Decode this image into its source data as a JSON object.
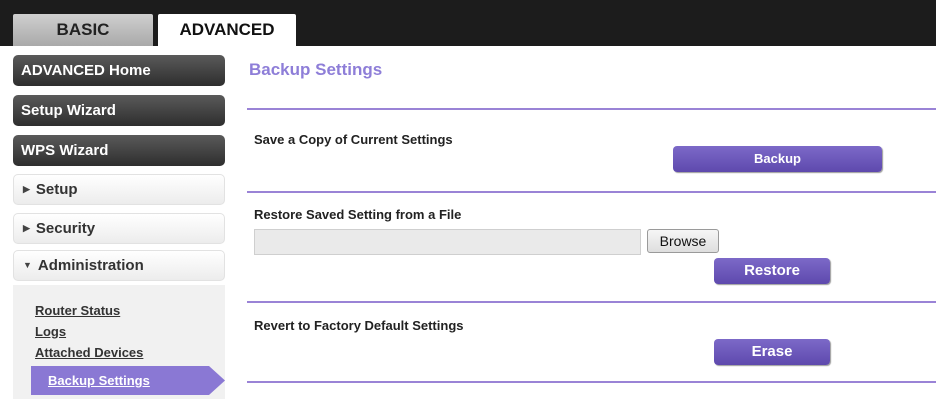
{
  "tabs": {
    "basic": "BASIC",
    "advanced": "ADVANCED"
  },
  "sidebar": {
    "dark_items": [
      "ADVANCED Home",
      "Setup Wizard",
      "WPS Wizard"
    ],
    "light_items": [
      "Setup",
      "Security",
      "Administration"
    ],
    "admin_sublinks": [
      "Router Status",
      "Logs",
      "Attached Devices",
      "Backup Settings"
    ]
  },
  "main": {
    "title": "Backup Settings",
    "save_label": "Save a Copy of Current Settings",
    "backup_button": "Backup",
    "restore_label": "Restore Saved Setting from a File",
    "file_value": "",
    "browse_button": "Browse",
    "restore_button": "Restore",
    "revert_label": "Revert to Factory Default Settings",
    "erase_button": "Erase"
  },
  "colors": {
    "accent": "#8a78d4",
    "button": "#6a56bb",
    "topbar": "#1c1c1c"
  }
}
